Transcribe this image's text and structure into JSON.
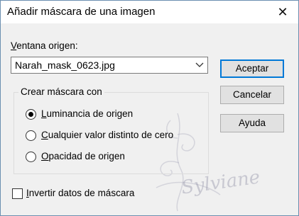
{
  "dialog": {
    "title": "Añadir máscara de una imagen",
    "close_glyph": "✕"
  },
  "source": {
    "label": "Ventana origen:",
    "selected": "Narah_mask_0623.jpg"
  },
  "buttons": {
    "accept": "Aceptar",
    "cancel": "Cancelar",
    "help": "Ayuda"
  },
  "mask_group": {
    "legend": "Crear máscara con",
    "options": [
      {
        "label": "Luminancia de origen",
        "selected": true
      },
      {
        "label": "Cualquier valor distinto de cero",
        "selected": false
      },
      {
        "label": "Opacidad de origen",
        "selected": false
      }
    ]
  },
  "invert": {
    "label": "Invertir datos de máscara",
    "checked": false
  },
  "watermark": {
    "text": "Sylviane"
  },
  "colors": {
    "accent": "#0078d7",
    "window_bg": "#f0f0f0",
    "titlebar_bg": "#ffffff"
  }
}
